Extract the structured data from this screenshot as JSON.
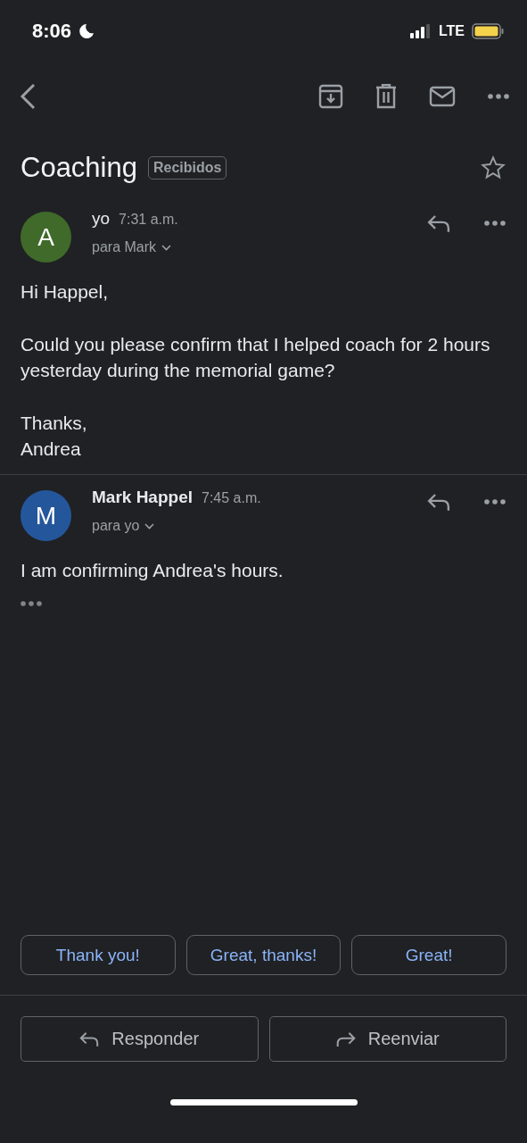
{
  "status_bar": {
    "time": "8:06",
    "network": "LTE"
  },
  "subject": {
    "title": "Coaching",
    "label": "Recibidos",
    "starred": false
  },
  "messages": [
    {
      "initial": "A",
      "color": "#3f6a2a",
      "sender": "yo",
      "sender_bold": false,
      "time": "7:31 a.m.",
      "recipients": "para Mark",
      "paragraphs": [
        "Hi Happel,",
        "Could you please confirm that I helped coach for 2 hours yesterday during the memorial game?",
        "Thanks,\nAndrea"
      ]
    },
    {
      "initial": "M",
      "color": "#24569c",
      "sender": "Mark Happel",
      "sender_bold": true,
      "time": "7:45 a.m.",
      "recipients": "para yo",
      "paragraphs": [
        "I am confirming Andrea's hours."
      ],
      "quoted_hidden": true
    }
  ],
  "smart_replies": [
    "Thank you!",
    "Great, thanks!",
    "Great!"
  ],
  "actions": [
    {
      "kind": "reply",
      "label": "Responder"
    },
    {
      "kind": "forward",
      "label": "Reenviar"
    }
  ]
}
